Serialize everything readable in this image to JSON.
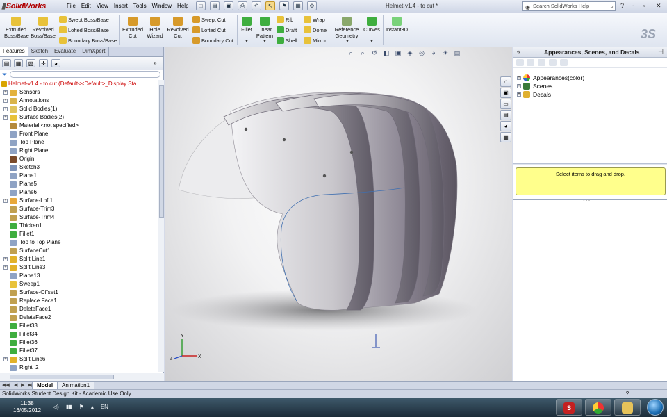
{
  "app": {
    "logo": "SolidWorks",
    "menus": [
      "File",
      "Edit",
      "View",
      "Insert",
      "Tools",
      "Window",
      "Help"
    ],
    "doc_title": "Helmet-v1.4 - to cut *",
    "help_placeholder": "Search SolidWorks Help",
    "window_controls": [
      "?",
      "-",
      "▫",
      "✕"
    ]
  },
  "ribbon": {
    "buttons": [
      {
        "label": "Extruded\nBoss/Base"
      },
      {
        "label": "Revolved\nBoss/Base"
      },
      {
        "label": "Swept Boss/Base"
      },
      {
        "label": "Lofted Boss/Base"
      },
      {
        "label": "Boundary Boss/Base"
      },
      {
        "label": "Extruded\nCut"
      },
      {
        "label": "Hole\nWizard"
      },
      {
        "label": "Revolved\nCut"
      },
      {
        "label": "Swept Cut"
      },
      {
        "label": "Lofted Cut"
      },
      {
        "label": "Boundary Cut"
      },
      {
        "label": "Fillet"
      },
      {
        "label": "Linear\nPattern"
      },
      {
        "label": "Rib"
      },
      {
        "label": "Draft"
      },
      {
        "label": "Shell"
      },
      {
        "label": "Wrap"
      },
      {
        "label": "Dome"
      },
      {
        "label": "Mirror"
      },
      {
        "label": "Reference\nGeometry"
      },
      {
        "label": "Curves"
      },
      {
        "label": "Instant3D"
      }
    ]
  },
  "feature_manager": {
    "tabs": [
      "Features",
      "Sketch",
      "Evaluate",
      "DimXpert"
    ],
    "root": "Helmet-v1.4 - to cut  (Default<<Default>_Display Sta",
    "items": [
      "Sensors",
      "Annotations",
      "Solid Bodies(1)",
      "Surface Bodies(2)",
      "Material <not specified>",
      "Front Plane",
      "Top Plane",
      "Right Plane",
      "Origin",
      "Sketch3",
      "Plane1",
      "Plane5",
      "Plane6",
      "Surface-Loft1",
      "Surface-Trim3",
      "Surface-Trim4",
      "Thicken1",
      "Fillet1",
      "Top to Top Plane",
      "SurfaceCut1",
      "Split Line1",
      "Split Line3",
      "Plane13",
      "Sweep1",
      "Surface-Offset1",
      "Replace Face1",
      "DeleteFace1",
      "DeleteFace2",
      "Fillet33",
      "Fillet34",
      "Fillet36",
      "Fillet37",
      "Split Line6",
      "Right_2"
    ]
  },
  "model_tabs": [
    "Model",
    "Animation1"
  ],
  "status": "SolidWorks Student Design Kit - Academic Use Only",
  "task_pane": {
    "title": "Appearances, Scenes, and Decals",
    "nodes": [
      "Appearances(color)",
      "Scenes",
      "Decals"
    ],
    "drop_hint": "Select items to drag and drop."
  },
  "taskbar": {
    "time": "11:38",
    "date": "16/05/2012",
    "lang": "EN"
  },
  "triad_axes": [
    "Y",
    "X",
    "Z"
  ],
  "colors": {
    "accent_red": "#c00000",
    "drop_yellow": "#ffff8c",
    "ribbon_icon_yellow": "#e8c23a",
    "ribbon_icon_green": "#3fae3f"
  }
}
